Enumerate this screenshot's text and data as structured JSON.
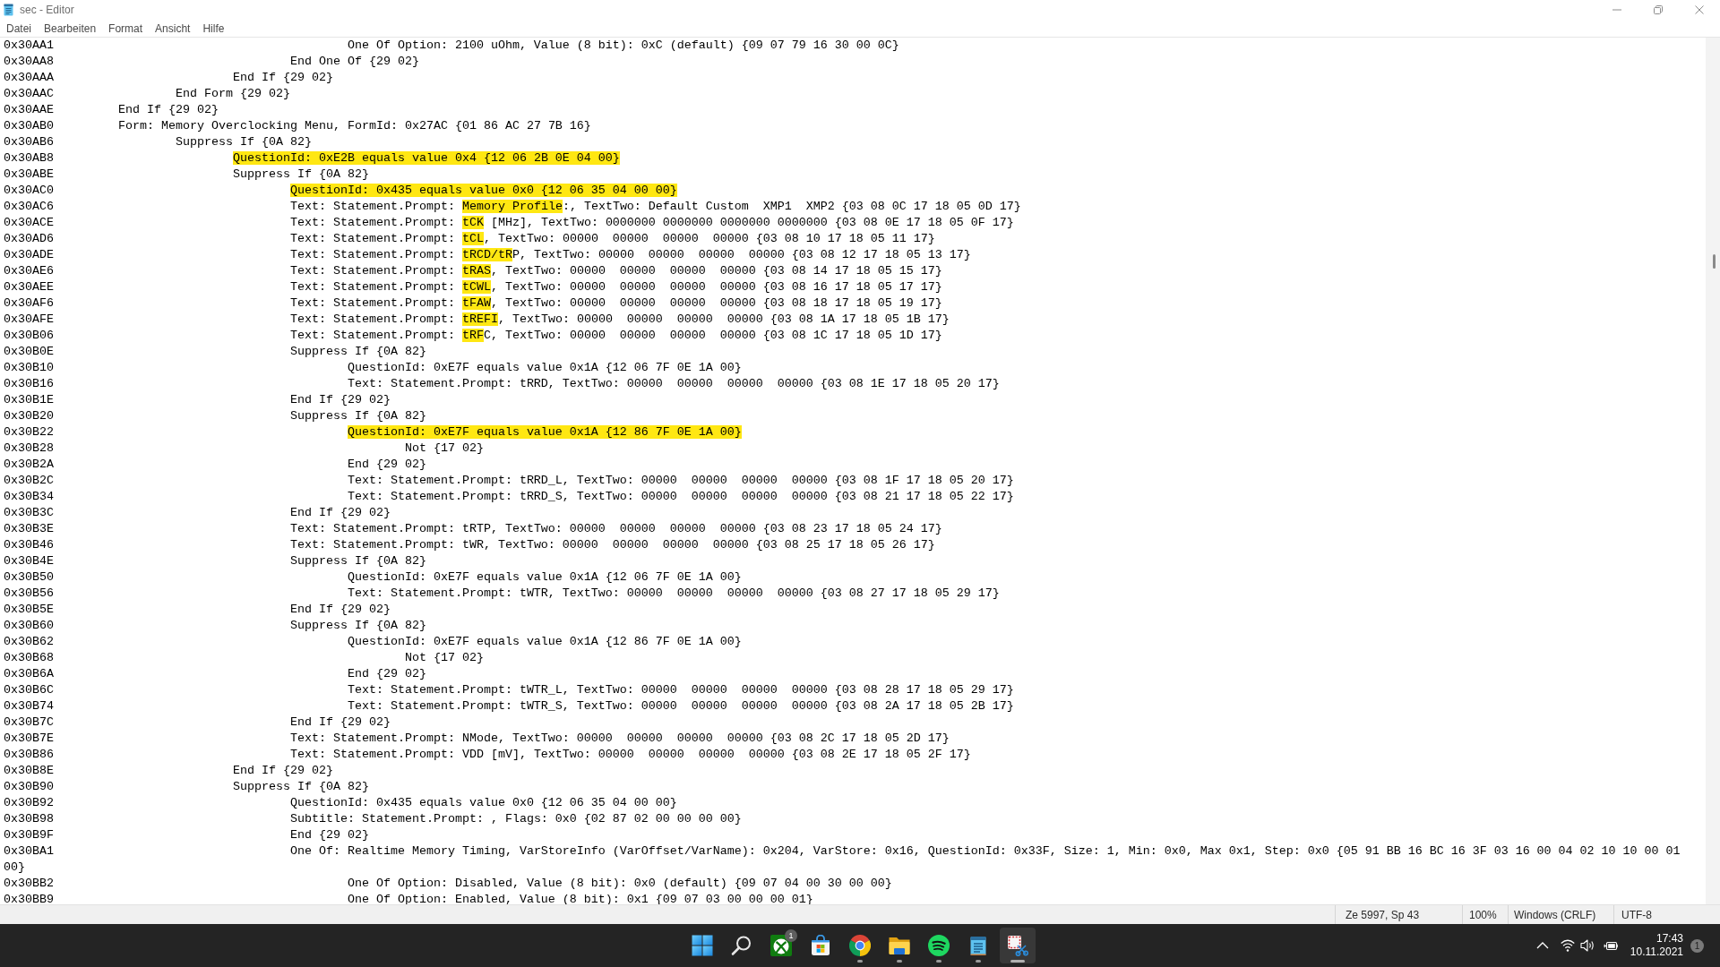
{
  "window": {
    "title": "sec - Editor"
  },
  "menu": [
    "Datei",
    "Bearbeiten",
    "Format",
    "Ansicht",
    "Hilfe"
  ],
  "editor": {
    "lines": [
      {
        "address": "0x30AA1",
        "text": "\t\t\t\tOne Of Option: 2100 uOhm, Value (8 bit): 0xC (default) {09 07 79 16 30 00 0C}"
      },
      {
        "address": "0x30AA8",
        "text": "\t\t\tEnd One Of {29 02}"
      },
      {
        "address": "0x30AAA",
        "text": "\t\tEnd If {29 02}"
      },
      {
        "address": "0x30AAC",
        "text": "\tEnd Form {29 02}"
      },
      {
        "address": "0x30AAE",
        "text": "End If {29 02}"
      },
      {
        "address": "0x30AB0",
        "text": "Form: Memory Overclocking Menu, FormId: 0x27AC {01 86 AC 27 7B 16}"
      },
      {
        "address": "0x30AB6",
        "text": "\tSuppress If {0A 82}"
      },
      {
        "address": "0x30AB8",
        "segments": [
          {
            "text": "\t\tQuestionId: 0xE2B equals value 0x4 {12 06 2B 0E 04 00}",
            "highlighted": true
          }
        ]
      },
      {
        "address": "0x30ABE",
        "text": "\t\tSuppress If {0A 82}"
      },
      {
        "address": "0x30AC0",
        "segments": [
          {
            "text": "\t\t\tQuestionId: 0x435 equals value 0x0 {12 06 35 04 00 00}",
            "highlighted": true
          }
        ]
      },
      {
        "address": "0x30AC6",
        "segments": [
          {
            "text": "\t\t\tText: Statement.Prompt: ",
            "highlighted": false
          },
          {
            "text": "Memory Profile",
            "highlighted": true
          },
          {
            "text": ":, TextTwo: Default Custom  XMP1  XMP2 {03 08 0C 17 18 05 0D 17}",
            "highlighted": false
          }
        ]
      },
      {
        "address": "0x30ACE",
        "segments": [
          {
            "text": "\t\t\tText: Statement.Prompt: ",
            "highlighted": false
          },
          {
            "text": "tCK",
            "highlighted": true
          },
          {
            "text": " [MHz], TextTwo: 0000000 0000000 0000000 0000000 {03 08 0E 17 18 05 0F 17}",
            "highlighted": false
          }
        ]
      },
      {
        "address": "0x30AD6",
        "segments": [
          {
            "text": "\t\t\tText: Statement.Prompt: ",
            "highlighted": false
          },
          {
            "text": "tCL",
            "highlighted": true
          },
          {
            "text": ", TextTwo: 00000  00000  00000  00000 {03 08 10 17 18 05 11 17}",
            "highlighted": false
          }
        ]
      },
      {
        "address": "0x30ADE",
        "segments": [
          {
            "text": "\t\t\tText: Statement.Prompt: ",
            "highlighted": false
          },
          {
            "text": "tRCD/tR",
            "highlighted": true
          },
          {
            "text": "P, TextTwo: 00000  00000  00000  00000 {03 08 12 17 18 05 13 17}",
            "highlighted": false
          }
        ]
      },
      {
        "address": "0x30AE6",
        "segments": [
          {
            "text": "\t\t\tText: Statement.Prompt: ",
            "highlighted": false
          },
          {
            "text": "tRAS",
            "highlighted": true
          },
          {
            "text": ", TextTwo: 00000  00000  00000  00000 {03 08 14 17 18 05 15 17}",
            "highlighted": false
          }
        ]
      },
      {
        "address": "0x30AEE",
        "segments": [
          {
            "text": "\t\t\tText: Statement.Prompt: ",
            "highlighted": false
          },
          {
            "text": "tCWL",
            "highlighted": true
          },
          {
            "text": ", TextTwo: 00000  00000  00000  00000 {03 08 16 17 18 05 17 17}",
            "highlighted": false
          }
        ]
      },
      {
        "address": "0x30AF6",
        "segments": [
          {
            "text": "\t\t\tText: Statement.Prompt: ",
            "highlighted": false
          },
          {
            "text": "tFAW",
            "highlighted": true
          },
          {
            "text": ", TextTwo: 00000  00000  00000  00000 {03 08 18 17 18 05 19 17}",
            "highlighted": false
          }
        ]
      },
      {
        "address": "0x30AFE",
        "segments": [
          {
            "text": "\t\t\tText: Statement.Prompt: ",
            "highlighted": false
          },
          {
            "text": "tREFI",
            "highlighted": true
          },
          {
            "text": ", TextTwo: 00000  00000  00000  00000 {03 08 1A 17 18 05 1B 17}",
            "highlighted": false
          }
        ]
      },
      {
        "address": "0x30B06",
        "segments": [
          {
            "text": "\t\t\tText: Statement.Prompt: ",
            "highlighted": false
          },
          {
            "text": "tRF",
            "highlighted": true
          },
          {
            "text": "C, TextTwo: 00000  00000  00000  00000 {03 08 1C 17 18 05 1D 17}",
            "highlighted": false
          }
        ]
      },
      {
        "address": "0x30B0E",
        "text": "\t\t\tSuppress If {0A 82}"
      },
      {
        "address": "0x30B10",
        "text": "\t\t\t\tQuestionId: 0xE7F equals value 0x1A {12 06 7F 0E 1A 00}"
      },
      {
        "address": "0x30B16",
        "text": "\t\t\t\tText: Statement.Prompt: tRRD, TextTwo: 00000  00000  00000  00000 {03 08 1E 17 18 05 20 17}"
      },
      {
        "address": "0x30B1E",
        "text": "\t\t\tEnd If {29 02}"
      },
      {
        "address": "0x30B20",
        "text": "\t\t\tSuppress If {0A 82}"
      },
      {
        "address": "0x30B22",
        "segments": [
          {
            "text": "\t\t\t\tQuestionId: 0xE7F equals value 0x1A {12 86 7F 0E 1A 00}",
            "highlighted": true
          }
        ]
      },
      {
        "address": "0x30B28",
        "text": "\t\t\t\t\tNot {17 02}"
      },
      {
        "address": "0x30B2A",
        "text": "\t\t\t\tEnd {29 02}"
      },
      {
        "address": "0x30B2C",
        "text": "\t\t\t\tText: Statement.Prompt: tRRD_L, TextTwo: 00000  00000  00000  00000 {03 08 1F 17 18 05 20 17}"
      },
      {
        "address": "0x30B34",
        "text": "\t\t\t\tText: Statement.Prompt: tRRD_S, TextTwo: 00000  00000  00000  00000 {03 08 21 17 18 05 22 17}"
      },
      {
        "address": "0x30B3C",
        "text": "\t\t\tEnd If {29 02}"
      },
      {
        "address": "0x30B3E",
        "text": "\t\t\tText: Statement.Prompt: tRTP, TextTwo: 00000  00000  00000  00000 {03 08 23 17 18 05 24 17}"
      },
      {
        "address": "0x30B46",
        "text": "\t\t\tText: Statement.Prompt: tWR, TextTwo: 00000  00000  00000  00000 {03 08 25 17 18 05 26 17}"
      },
      {
        "address": "0x30B4E",
        "text": "\t\t\tSuppress If {0A 82}"
      },
      {
        "address": "0x30B50",
        "text": "\t\t\t\tQuestionId: 0xE7F equals value 0x1A {12 06 7F 0E 1A 00}"
      },
      {
        "address": "0x30B56",
        "text": "\t\t\t\tText: Statement.Prompt: tWTR, TextTwo: 00000  00000  00000  00000 {03 08 27 17 18 05 29 17}"
      },
      {
        "address": "0x30B5E",
        "text": "\t\t\tEnd If {29 02}"
      },
      {
        "address": "0x30B60",
        "text": "\t\t\tSuppress If {0A 82}"
      },
      {
        "address": "0x30B62",
        "text": "\t\t\t\tQuestionId: 0xE7F equals value 0x1A {12 86 7F 0E 1A 00}"
      },
      {
        "address": "0x30B68",
        "text": "\t\t\t\t\tNot {17 02}"
      },
      {
        "address": "0x30B6A",
        "text": "\t\t\t\tEnd {29 02}"
      },
      {
        "address": "0x30B6C",
        "text": "\t\t\t\tText: Statement.Prompt: tWTR_L, TextTwo: 00000  00000  00000  00000 {03 08 28 17 18 05 29 17}"
      },
      {
        "address": "0x30B74",
        "text": "\t\t\t\tText: Statement.Prompt: tWTR_S, TextTwo: 00000  00000  00000  00000 {03 08 2A 17 18 05 2B 17}"
      },
      {
        "address": "0x30B7C",
        "text": "\t\t\tEnd If {29 02}"
      },
      {
        "address": "0x30B7E",
        "text": "\t\t\tText: Statement.Prompt: NMode, TextTwo: 00000  00000  00000  00000 {03 08 2C 17 18 05 2D 17}"
      },
      {
        "address": "0x30B86",
        "text": "\t\t\tText: Statement.Prompt: VDD [mV], TextTwo: 00000  00000  00000  00000 {03 08 2E 17 18 05 2F 17}"
      },
      {
        "address": "0x30B8E",
        "text": "\t\tEnd If {29 02}"
      },
      {
        "address": "0x30B90",
        "text": "\t\tSuppress If {0A 82}"
      },
      {
        "address": "0x30B92",
        "text": "\t\t\tQuestionId: 0x435 equals value 0x0 {12 06 35 04 00 00}"
      },
      {
        "address": "0x30B98",
        "text": "\t\t\tSubtitle: Statement.Prompt: , Flags: 0x0 {02 87 02 00 00 00 00}"
      },
      {
        "address": "0x30B9F",
        "text": "\t\t\tEnd {29 02}"
      },
      {
        "address": "0x30BA1",
        "text": "\t\t\tOne Of: Realtime Memory Timing, VarStoreInfo (VarOffset/VarName): 0x204, VarStore: 0x16, QuestionId: 0x33F, Size: 1, Min: 0x0, Max 0x1, Step: 0x0 {05 91 BB 16 BC 16 3F 03 16 00 04 02 10 10 00 01"
      },
      {
        "text": "00}"
      },
      {
        "address": "0x30BB2",
        "text": "\t\t\t\tOne Of Option: Disabled, Value (8 bit): 0x0 (default) {09 07 04 00 30 00 00}"
      },
      {
        "address": "0x30BB9",
        "text": "\t\t\t\tOne Of Option: Enabled, Value (8 bit): 0x1 {09 07 03 00 00 00 01}"
      }
    ]
  },
  "status_bar": {
    "position": "Ze 5997, Sp 43",
    "zoom": "100%",
    "line_ending": "Windows (CRLF)",
    "encoding": "UTF-8"
  },
  "taskbar": {
    "apps": [
      {
        "kind": "start",
        "running": false,
        "selected": false
      },
      {
        "kind": "search",
        "running": false,
        "selected": false
      },
      {
        "kind": "game",
        "running": false,
        "selected": false,
        "badge": "1"
      },
      {
        "kind": "store",
        "running": false,
        "selected": false
      },
      {
        "kind": "browser",
        "running": true,
        "selected": false
      },
      {
        "kind": "files",
        "running": true,
        "selected": false
      },
      {
        "kind": "music",
        "running": true,
        "selected": false
      },
      {
        "kind": "notepad",
        "running": true,
        "selected": false
      },
      {
        "kind": "snipping",
        "running": true,
        "selected": true
      }
    ],
    "tray": {
      "time": "17:43",
      "date": "10.11.2021",
      "notifications": "1"
    }
  }
}
